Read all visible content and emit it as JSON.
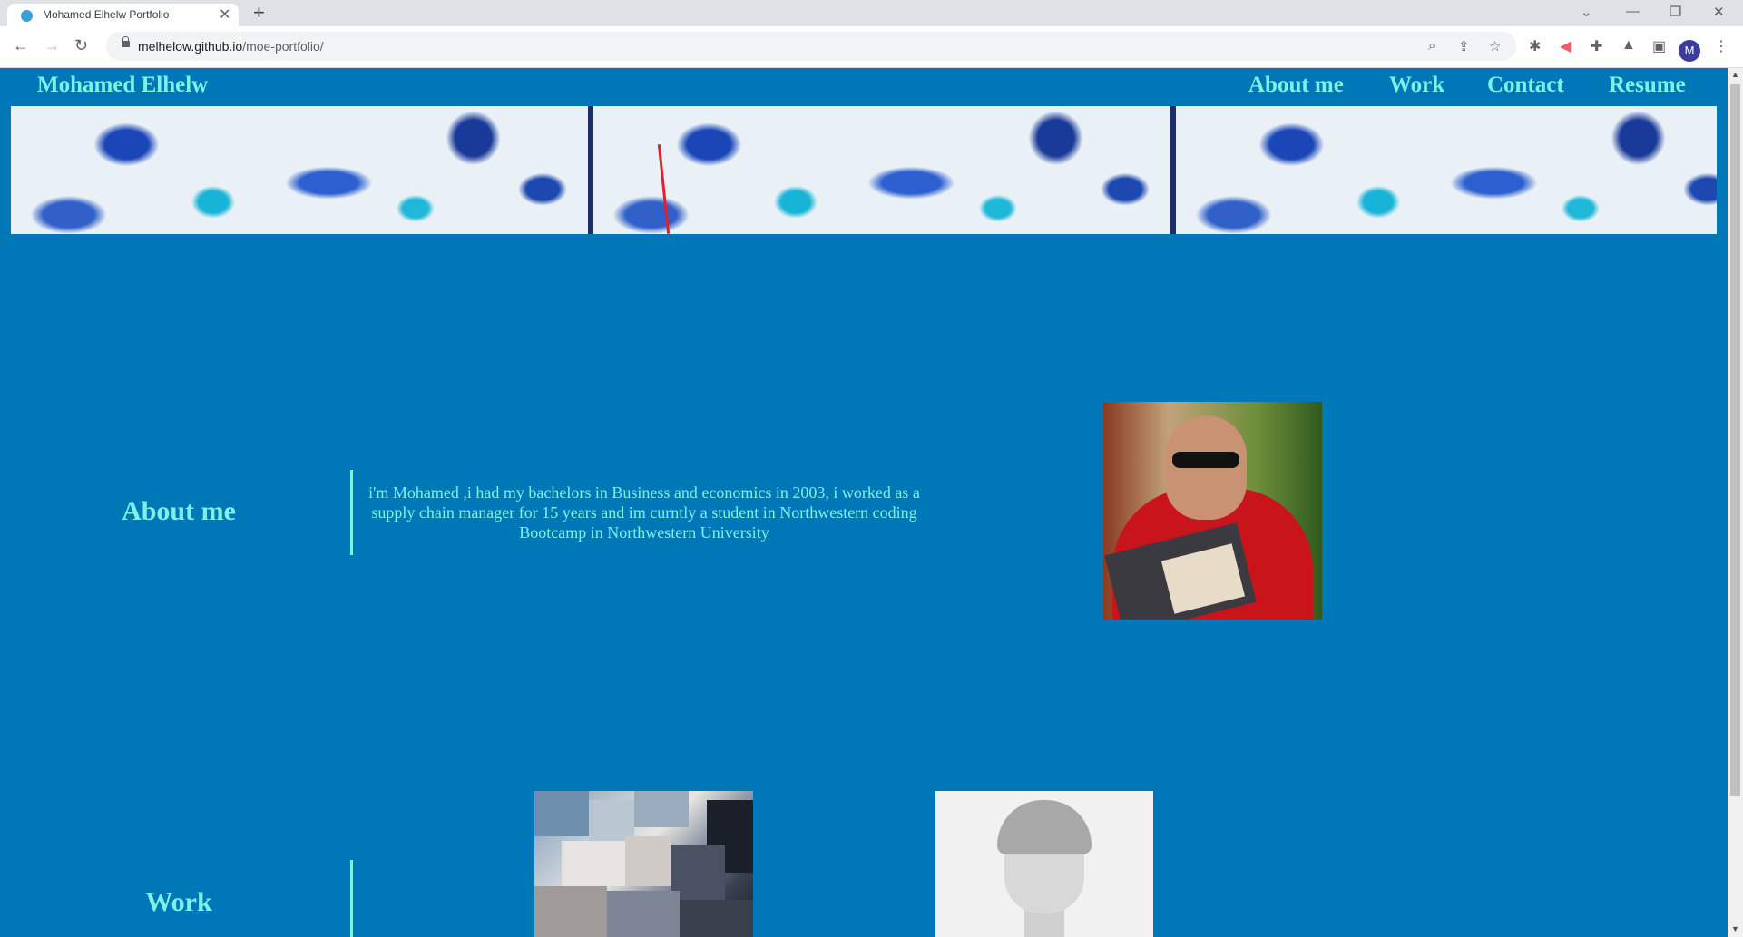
{
  "browser": {
    "tab_title": "Mohamed Elhelw Portfolio",
    "url_host": "melhelow.github.io",
    "url_path": "/moe-portfolio/",
    "profile_initial": "M"
  },
  "site": {
    "title": "Mohamed Elhelw",
    "nav": {
      "about": "About me",
      "work": "Work",
      "contact": "Contact",
      "resume": "Resume"
    }
  },
  "about": {
    "heading": "About me",
    "text": "i'm Mohamed ,i had my bachelors in Business and economics in 2003, i worked as a supply chain manager for 15 years and im curntly a student in Northwestern coding Bootcamp in Northwestern University"
  },
  "work": {
    "heading": "Work"
  },
  "colors": {
    "page_background": "#0077b6",
    "accent_text": "#7ef0e6"
  }
}
